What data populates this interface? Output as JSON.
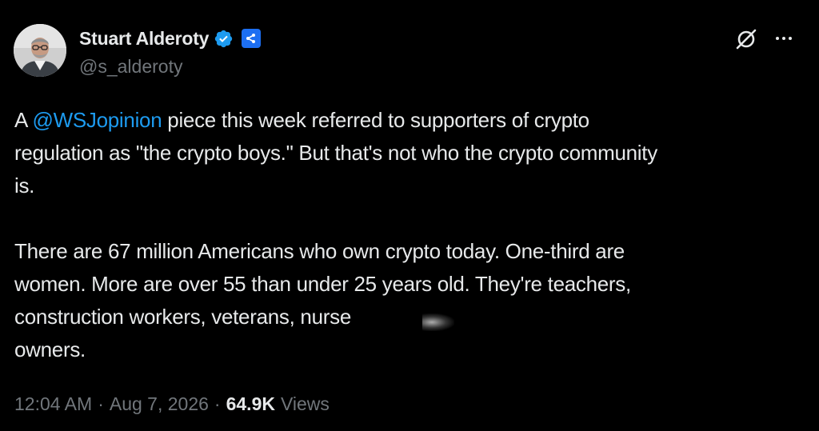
{
  "author": {
    "display_name": "Stuart Alderoty",
    "handle": "@s_alderoty",
    "verified": true,
    "affiliation_badge": "ripple-logo-icon"
  },
  "actions": {
    "grok_icon": "grok-icon",
    "more_icon": "more-horizontal-icon"
  },
  "post": {
    "p1_prefix": "A ",
    "mention": "@WSJopinion",
    "p1_line1_rest": " piece this week referred to supporters of crypto",
    "p1_line2": "regulation as \"the crypto boys.\" But that's not who the crypto community",
    "p1_line3": "is.",
    "p2_line1": "There are 67 million Americans who own crypto today. One-third are",
    "p2_line2": "women. More are over 55 than under 25 years old. They're teachers,",
    "p2_line3": "construction workers, veterans, nurse",
    "p2_line4": "owners."
  },
  "meta": {
    "time": "12:04 AM",
    "separator": "·",
    "date": "Aug 7, 2026",
    "views_count": "64.9K",
    "views_label": "Views"
  },
  "colors": {
    "background": "#000000",
    "text": "#e7e9ea",
    "secondary": "#71767b",
    "link": "#1d9bf0",
    "verified": "#1d9bf0"
  }
}
